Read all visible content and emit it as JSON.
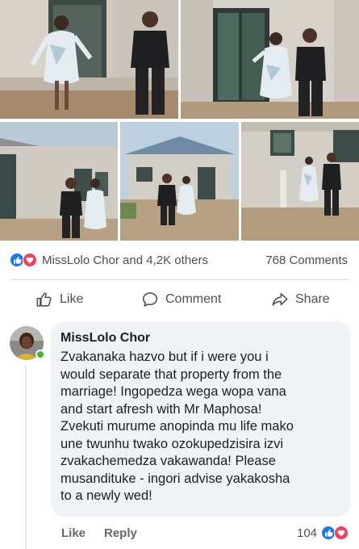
{
  "photos": [
    {
      "scene": "couple-front-of-house-left"
    },
    {
      "scene": "couple-at-doorway"
    },
    {
      "scene": "couple-side-of-house"
    },
    {
      "scene": "couple-walking-to-house"
    },
    {
      "scene": "couple-at-wall-corner"
    }
  ],
  "reactions": {
    "icons": [
      "like-icon",
      "love-icon"
    ],
    "summary": "MissLolo Chor and 4,2K others",
    "comments_count": "768 Comments"
  },
  "actions": {
    "like": "Like",
    "comment": "Comment",
    "share": "Share"
  },
  "comment": {
    "author": "MissLolo Chor",
    "lines": [
      "Zvakanaka hazvo but if i were you i",
      "would separate that property from the",
      "marriage!  Ingopedza wega wopa vana",
      "and start afresh with Mr Maphosa!",
      "Zvekuti murume anopinda mu life mako",
      "une twunhu twako ozokupedzisira izvi",
      "zvakachemedza vakawanda!   Please",
      "musandituke - ingori advise yakakosha",
      "to a newly wed!"
    ],
    "like_label": "Like",
    "reply_label": "Reply",
    "reaction_count": "104"
  },
  "colors": {
    "like_blue": "#1877f2",
    "love_red": "#f33e58",
    "online_green": "#42b72a"
  }
}
